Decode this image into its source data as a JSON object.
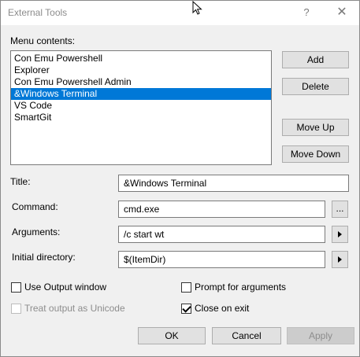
{
  "window": {
    "title": "External Tools",
    "help_glyph": "?",
    "close_glyph": "✕"
  },
  "menu": {
    "label": "Menu contents:",
    "items": [
      {
        "label": "Con Emu Powershell",
        "selected": false
      },
      {
        "label": "Explorer",
        "selected": false
      },
      {
        "label": "Con Emu Powershell Admin",
        "selected": false
      },
      {
        "label": "&Windows Terminal",
        "selected": true
      },
      {
        "label": "VS Code",
        "selected": false
      },
      {
        "label": "SmartGit",
        "selected": false
      }
    ]
  },
  "side_buttons": {
    "add": "Add",
    "delete": "Delete",
    "move_up": "Move Up",
    "move_down": "Move Down"
  },
  "fields": {
    "title_label": "Title:",
    "title_value": "&Windows Terminal",
    "command_label": "Command:",
    "command_value": "cmd.exe",
    "browse_glyph": "...",
    "arguments_label": "Arguments:",
    "arguments_value": "/c start wt",
    "initial_dir_label": "Initial directory:",
    "initial_dir_value": "$(ItemDir)"
  },
  "options": {
    "use_output_window": {
      "label": "Use Output window",
      "checked": false,
      "enabled": true
    },
    "prompt_for_arguments": {
      "label": "Prompt for arguments",
      "checked": false,
      "enabled": true
    },
    "treat_output_unicode": {
      "label": "Treat output as Unicode",
      "checked": false,
      "enabled": false
    },
    "close_on_exit": {
      "label": "Close on exit",
      "checked": true,
      "enabled": true
    }
  },
  "footer": {
    "ok": "OK",
    "cancel": "Cancel",
    "apply": "Apply"
  },
  "colors": {
    "selection": "#0078d7",
    "dialog_bg": "#f0f0f0",
    "button_bg": "#e1e1e1"
  }
}
